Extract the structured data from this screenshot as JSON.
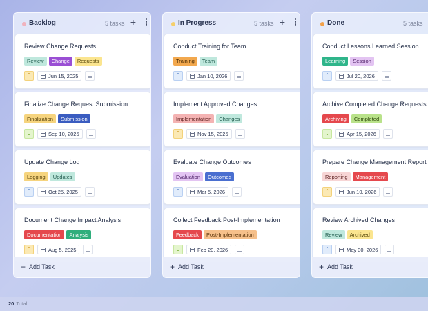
{
  "columns": [
    {
      "title": "Backlog",
      "count": "5 tasks",
      "dot_color": "#f0b3be",
      "add_task": "Add Task",
      "cards": [
        {
          "title": "Review Change Requests",
          "tags": [
            {
              "label": "Review",
              "bg": "#bfe8dd",
              "fg": "#1f5a4c"
            },
            {
              "label": "Change",
              "bg": "#9a4fd4",
              "fg": "#ffffff"
            },
            {
              "label": "Requests",
              "bg": "#fbe58f",
              "fg": "#5a4a0e"
            }
          ],
          "priority": "high",
          "priority_icon": "double-chevron-up-icon",
          "date": "Jun 15, 2025"
        },
        {
          "title": "Finalize Change Request Submission",
          "tags": [
            {
              "label": "Finalization",
              "bg": "#f6d47e",
              "fg": "#5a450e"
            },
            {
              "label": "Submission",
              "bg": "#3a5cc0",
              "fg": "#ffffff"
            }
          ],
          "priority": "low",
          "priority_icon": "chevron-down-icon",
          "date": "Sep 10, 2025"
        },
        {
          "title": "Update Change Log",
          "tags": [
            {
              "label": "Logging",
              "bg": "#f6d47e",
              "fg": "#5a450e"
            },
            {
              "label": "Updates",
              "bg": "#bfe8dd",
              "fg": "#1f5a4c"
            }
          ],
          "priority": "med",
          "priority_icon": "chevron-up-icon",
          "date": "Oct 25, 2025"
        },
        {
          "title": "Document Change Impact Analysis",
          "tags": [
            {
              "label": "Documentation",
              "bg": "#e5484d",
              "fg": "#ffffff"
            },
            {
              "label": "Analysis",
              "bg": "#2fae7c",
              "fg": "#ffffff"
            }
          ],
          "priority": "high",
          "priority_icon": "double-chevron-up-icon",
          "date": "Aug 5, 2025"
        }
      ]
    },
    {
      "title": "In Progress",
      "count": "5 tasks",
      "dot_color": "#f5cf6a",
      "add_task": "Add Task",
      "cards": [
        {
          "title": "Conduct Training for Team",
          "tags": [
            {
              "label": "Training",
              "bg": "#f2a84e",
              "fg": "#4a2c05"
            },
            {
              "label": "Team",
              "bg": "#bfe8dd",
              "fg": "#1f5a4c"
            }
          ],
          "priority": "med",
          "priority_icon": "chevron-up-icon",
          "date": "Jan 10, 2026"
        },
        {
          "title": "Implement Approved Changes",
          "tags": [
            {
              "label": "Implementation",
              "bg": "#f4b3b3",
              "fg": "#5a1e1e"
            },
            {
              "label": "Changes",
              "bg": "#bfe8dd",
              "fg": "#1f5a4c"
            }
          ],
          "priority": "high",
          "priority_icon": "double-chevron-up-icon",
          "date": "Nov 15, 2025"
        },
        {
          "title": "Evaluate Change Outcomes",
          "tags": [
            {
              "label": "Evaluation",
              "bg": "#e3c4f2",
              "fg": "#4d1f66"
            },
            {
              "label": "Outcomes",
              "bg": "#4a6fd0",
              "fg": "#ffffff"
            }
          ],
          "priority": "med",
          "priority_icon": "chevron-up-icon",
          "date": "Mar 5, 2026"
        },
        {
          "title": "Collect Feedback Post-Implementation",
          "tags": [
            {
              "label": "Feedback",
              "bg": "#e5484d",
              "fg": "#ffffff"
            },
            {
              "label": "Post-Implementation",
              "bg": "#f6c08a",
              "fg": "#5a330a"
            }
          ],
          "priority": "low",
          "priority_icon": "chevron-down-icon",
          "date": "Feb 20, 2026"
        }
      ]
    },
    {
      "title": "Done",
      "count": "5 tasks",
      "dot_color": "#f2a14a",
      "add_task": "Add Task",
      "cards": [
        {
          "title": "Conduct Lessons Learned Session",
          "tags": [
            {
              "label": "Learning",
              "bg": "#2fb58a",
              "fg": "#ffffff"
            },
            {
              "label": "Session",
              "bg": "#e3c4f2",
              "fg": "#4d1f66"
            }
          ],
          "priority": "med",
          "priority_icon": "chevron-up-icon",
          "date": "Jul 20, 2026"
        },
        {
          "title": "Archive Completed Change Requests",
          "tags": [
            {
              "label": "Archiving",
              "bg": "#e5484d",
              "fg": "#ffffff"
            },
            {
              "label": "Completed",
              "bg": "#b9e28a",
              "fg": "#2f4a0c"
            }
          ],
          "priority": "low",
          "priority_icon": "chevron-down-icon",
          "date": "Apr 15, 2026"
        },
        {
          "title": "Prepare Change Management Report",
          "tags": [
            {
              "label": "Reporting",
              "bg": "#f7d5d5",
              "fg": "#5a1e1e"
            },
            {
              "label": "Management",
              "bg": "#e5484d",
              "fg": "#ffffff"
            }
          ],
          "priority": "high",
          "priority_icon": "double-chevron-up-icon",
          "date": "Jun 10, 2026"
        },
        {
          "title": "Review Archived Changes",
          "tags": [
            {
              "label": "Review",
              "bg": "#bfe8dd",
              "fg": "#1f5a4c"
            },
            {
              "label": "Archived",
              "bg": "#fbe58f",
              "fg": "#5a4a0e"
            }
          ],
          "priority": "med",
          "priority_icon": "chevron-up-icon",
          "date": "May 30, 2026"
        }
      ]
    }
  ],
  "footer": {
    "total_count": "20",
    "total_label": "Total"
  }
}
